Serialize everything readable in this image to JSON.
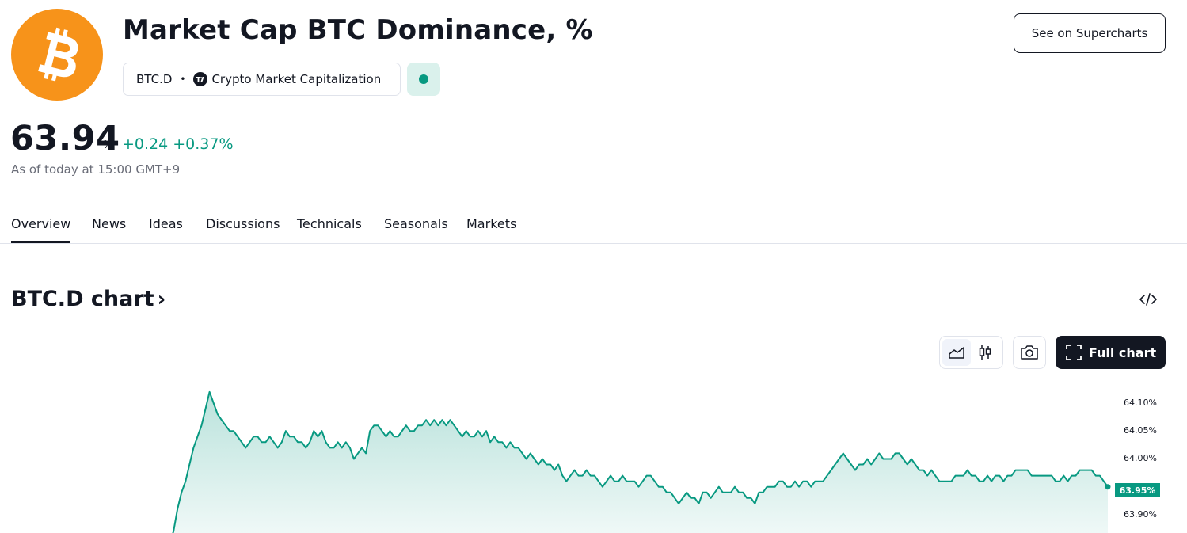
{
  "header": {
    "title": "Market Cap BTC Dominance, %",
    "symbol": "BTC.D",
    "separator": "•",
    "source": "Crypto Market Capitalization",
    "supercharts_button": "See on Supercharts",
    "logo_icon": "bitcoin-logo-icon",
    "status_icon": "market-open-dot-icon"
  },
  "quote": {
    "price": "63.94",
    "unit": "%",
    "change_abs": "+0.24",
    "change_pct": "+0.37%",
    "as_of": "As of today at 15:00 GMT+9"
  },
  "tabs": [
    "Overview",
    "News",
    "Ideas",
    "Discussions",
    "Technicals",
    "Seasonals",
    "Markets"
  ],
  "active_tab": "Overview",
  "chart_section": {
    "title": "BTC.D chart",
    "chevron": "›",
    "embed_icon": "code-embed-icon",
    "area_icon": "area-chart-icon",
    "candle_icon": "candlestick-icon",
    "snapshot_icon": "camera-icon",
    "full_chart_icon": "fullscreen-icon",
    "full_chart_label": "Full chart"
  },
  "colors": {
    "bitcoin_orange": "#f7931a",
    "up_green": "#089981",
    "text_dark": "#131722",
    "muted": "#6a6d78"
  },
  "chart_data": {
    "type": "area",
    "title": "",
    "xlabel": "",
    "ylabel": "",
    "y_ticks": [
      "64.10%",
      "64.05%",
      "64.00%",
      "63.95%",
      "63.90%"
    ],
    "y_tick_values": [
      64.1,
      64.05,
      64.0,
      63.9
    ],
    "ylim": [
      63.87,
      64.12
    ],
    "last_value_label": "63.95%",
    "grid": false,
    "legend": "none",
    "series": [
      {
        "values": [
          63.85,
          63.87,
          63.91,
          63.94,
          63.96,
          63.99,
          64.02,
          64.04,
          64.06,
          64.09,
          64.12,
          64.1,
          64.08,
          64.07,
          64.06,
          64.05,
          64.05,
          64.04,
          64.03,
          64.02,
          64.03,
          64.04,
          64.04,
          64.03,
          64.03,
          64.04,
          64.03,
          64.02,
          64.03,
          64.05,
          64.04,
          64.04,
          64.03,
          64.03,
          64.02,
          64.03,
          64.05,
          64.04,
          64.05,
          64.03,
          64.02,
          64.02,
          64.03,
          64.02,
          64.03,
          64.02,
          64.0,
          64.01,
          64.02,
          64.01,
          64.05,
          64.06,
          64.06,
          64.05,
          64.04,
          64.05,
          64.04,
          64.04,
          64.05,
          64.06,
          64.05,
          64.05,
          64.06,
          64.06,
          64.07,
          64.06,
          64.07,
          64.06,
          64.07,
          64.06,
          64.07,
          64.06,
          64.05,
          64.04,
          64.05,
          64.04,
          64.04,
          64.05,
          64.04,
          64.05,
          64.03,
          64.04,
          64.03,
          64.03,
          64.02,
          64.03,
          64.02,
          64.02,
          64.01,
          64.0,
          64.01,
          64.0,
          63.99,
          64.0,
          63.99,
          63.99,
          63.98,
          63.99,
          63.97,
          63.96,
          63.97,
          63.98,
          63.97,
          63.97,
          63.98,
          63.97,
          63.97,
          63.96,
          63.95,
          63.96,
          63.97,
          63.96,
          63.96,
          63.97,
          63.96,
          63.96,
          63.96,
          63.95,
          63.96,
          63.97,
          63.97,
          63.96,
          63.95,
          63.95,
          63.94,
          63.94,
          63.93,
          63.92,
          63.93,
          63.94,
          63.93,
          63.93,
          63.92,
          63.94,
          63.94,
          63.93,
          63.94,
          63.95,
          63.94,
          63.94,
          63.94,
          63.95,
          63.94,
          63.94,
          63.93,
          63.93,
          63.92,
          63.94,
          63.94,
          63.95,
          63.95,
          63.95,
          63.96,
          63.96,
          63.95,
          63.95,
          63.96,
          63.95,
          63.96,
          63.96,
          63.95,
          63.96,
          63.96,
          63.96,
          63.97,
          63.98,
          63.99,
          64.0,
          64.01,
          64.0,
          63.99,
          63.98,
          63.99,
          63.99,
          64.0,
          63.99,
          64.0,
          64.01,
          64.0,
          64.0,
          64.0,
          64.01,
          64.01,
          64.0,
          63.99,
          64.0,
          63.99,
          63.98,
          63.98,
          63.97,
          63.98,
          63.97,
          63.96,
          63.96,
          63.96,
          63.96,
          63.97,
          63.97,
          63.97,
          63.98,
          63.97,
          63.97,
          63.96,
          63.96,
          63.97,
          63.96,
          63.97,
          63.97,
          63.96,
          63.97,
          63.97,
          63.98,
          63.98,
          63.98,
          63.98,
          63.97,
          63.97,
          63.97,
          63.97,
          63.97,
          63.97,
          63.96,
          63.96,
          63.97,
          63.96,
          63.97,
          63.97,
          63.98,
          63.98,
          63.98,
          63.98,
          63.97,
          63.97,
          63.96,
          63.95
        ]
      }
    ]
  }
}
